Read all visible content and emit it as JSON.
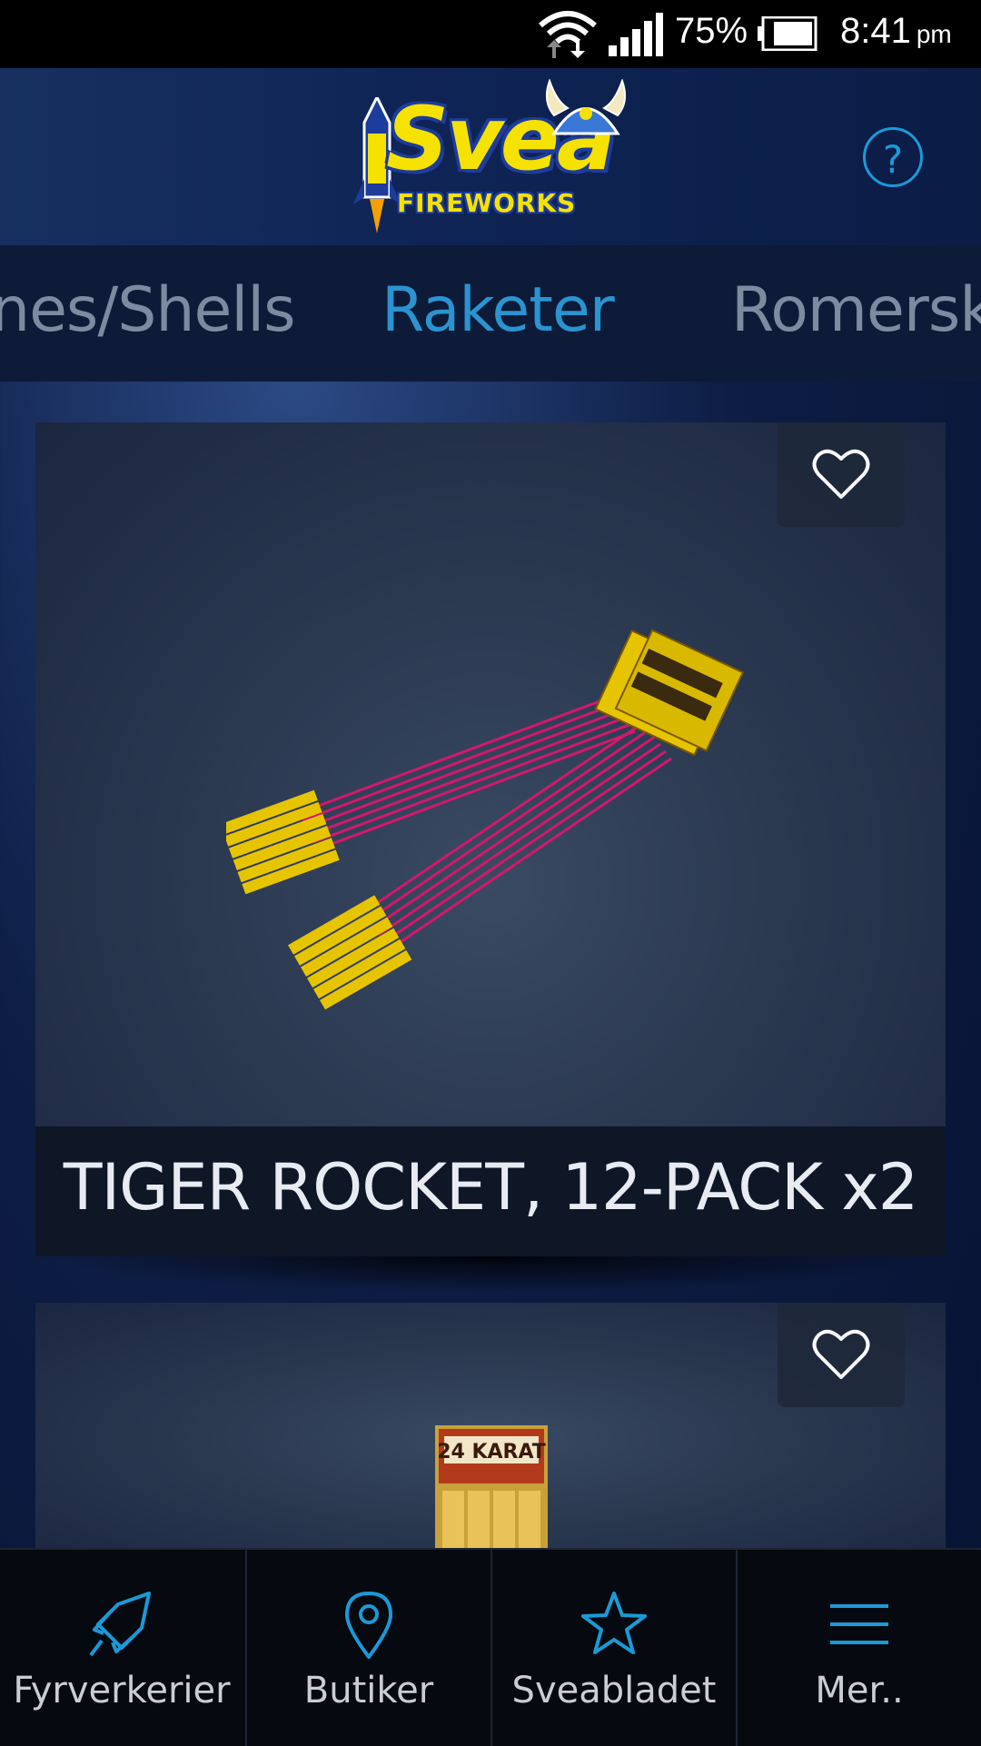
{
  "status_bar": {
    "battery_percent": "75%",
    "time": "8:41",
    "ampm": "pm",
    "icons": [
      "wifi-icon",
      "signal-icon",
      "battery-icon"
    ]
  },
  "header": {
    "logo_text": "Svea",
    "logo_subtext": "FIREWORKS",
    "help_label": "?"
  },
  "tabs": [
    {
      "label": "nes/Shells",
      "active": false
    },
    {
      "label": "Raketer",
      "active": true
    },
    {
      "label": "Romerska",
      "active": false
    }
  ],
  "products": [
    {
      "title": "TIGER ROCKET, 12-PACK x2",
      "favorite_icon": "heart-outline-icon"
    },
    {
      "title": "",
      "favorite_icon": "heart-outline-icon"
    }
  ],
  "bottom_nav": [
    {
      "label": "Fyrverkerier",
      "icon": "rocket-icon"
    },
    {
      "label": "Butiker",
      "icon": "map-pin-icon"
    },
    {
      "label": "Sveabladet",
      "icon": "star-icon"
    },
    {
      "label": "Mer..",
      "icon": "menu-icon"
    }
  ],
  "colors": {
    "accent": "#2a93d0",
    "logo_yellow": "#f6e200",
    "logo_blue": "#1d3c9b",
    "nav_bg": "#06090f"
  }
}
